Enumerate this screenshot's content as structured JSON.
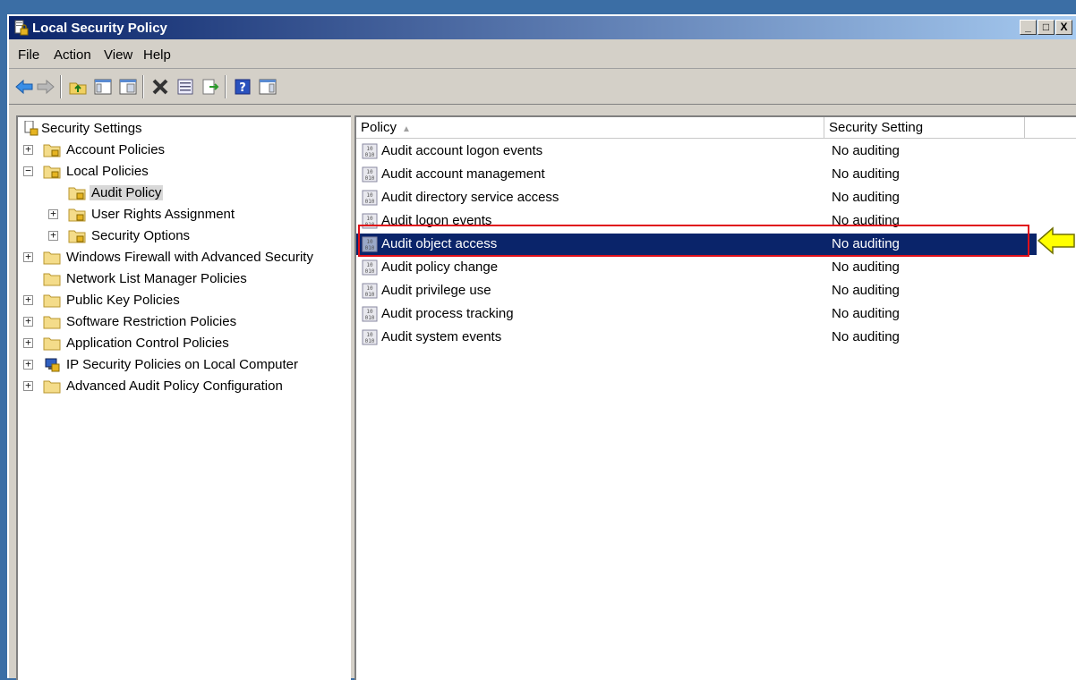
{
  "window": {
    "title": "Local Security Policy",
    "controls": [
      "_",
      "□",
      "X"
    ]
  },
  "menu": [
    "File",
    "Action",
    "View",
    "Help"
  ],
  "toolbar": [
    "back-icon",
    "forward-icon",
    "up-folder-icon",
    "show-hide-tree-icon",
    "delete-icon",
    "properties-icon",
    "export-list-icon",
    "help-icon",
    "show-hide-action-pane-icon"
  ],
  "tree": {
    "root": "Security Settings",
    "items": [
      {
        "label": "Account Policies",
        "level": 1,
        "expander": "+"
      },
      {
        "label": "Local Policies",
        "level": 1,
        "expander": "−"
      },
      {
        "label": "Audit Policy",
        "level": 2,
        "expander": "",
        "selected": true
      },
      {
        "label": "User Rights Assignment",
        "level": 2,
        "expander": "+"
      },
      {
        "label": "Security Options",
        "level": 2,
        "expander": "+"
      },
      {
        "label": "Windows Firewall with Advanced Security",
        "level": 1,
        "expander": "+"
      },
      {
        "label": "Network List Manager Policies",
        "level": 1,
        "expander": ""
      },
      {
        "label": "Public Key Policies",
        "level": 1,
        "expander": "+"
      },
      {
        "label": "Software Restriction Policies",
        "level": 1,
        "expander": "+"
      },
      {
        "label": "Application Control Policies",
        "level": 1,
        "expander": "+"
      },
      {
        "label": "IP Security Policies on Local Computer",
        "level": 1,
        "expander": "+"
      },
      {
        "label": "Advanced Audit Policy Configuration",
        "level": 1,
        "expander": "+"
      }
    ]
  },
  "list": {
    "columns": [
      "Policy",
      "Security Setting"
    ],
    "rows": [
      {
        "policy": "Audit account logon events",
        "setting": "No auditing"
      },
      {
        "policy": "Audit account management",
        "setting": "No auditing"
      },
      {
        "policy": "Audit directory service access",
        "setting": "No auditing"
      },
      {
        "policy": "Audit logon events",
        "setting": "No auditing"
      },
      {
        "policy": "Audit object access",
        "setting": "No auditing",
        "selected": true
      },
      {
        "policy": "Audit policy change",
        "setting": "No auditing"
      },
      {
        "policy": "Audit privilege use",
        "setting": "No auditing"
      },
      {
        "policy": "Audit process tracking",
        "setting": "No auditing"
      },
      {
        "policy": "Audit system events",
        "setting": "No auditing"
      }
    ]
  },
  "colors": {
    "desktop": "#3b6ea5",
    "titlebar_start": "#0a246a",
    "selection": "#0a246a",
    "annotation_box": "#e0101a",
    "annotation_arrow": "#ffff00"
  }
}
